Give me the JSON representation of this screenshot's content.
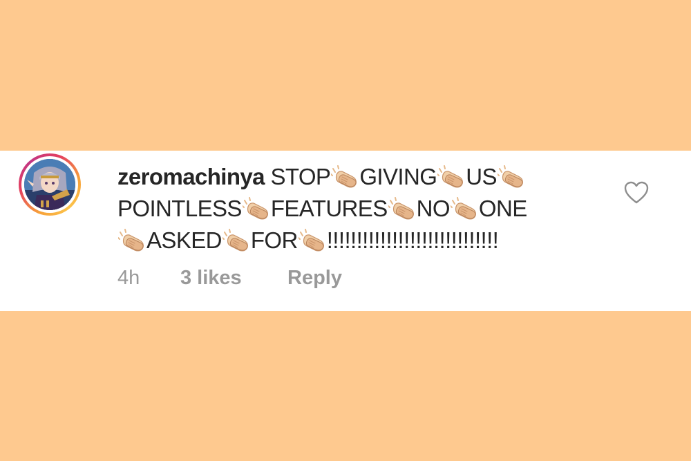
{
  "comment": {
    "username": "zeromachinya",
    "words_line1": [
      "STOP",
      "GIVING",
      "US"
    ],
    "words_line2": [
      "POINTLESS",
      "FEATURES",
      "NO",
      "ONE"
    ],
    "words_line3": [
      "ASKED",
      "FOR",
      "!!!!!!!!!!!!!!!!!!!!!!!!!!!!!"
    ],
    "separator_icon": "clapping-hands-icon"
  },
  "meta": {
    "time": "4h",
    "likes": "3 likes",
    "reply": "Reply"
  },
  "icons": {
    "like": "heart-outline-icon",
    "avatar": "anime-character-avatar"
  },
  "colors": {
    "background": "#fec98f",
    "card": "#ffffff",
    "text": "#262626",
    "meta_text": "#999999"
  }
}
